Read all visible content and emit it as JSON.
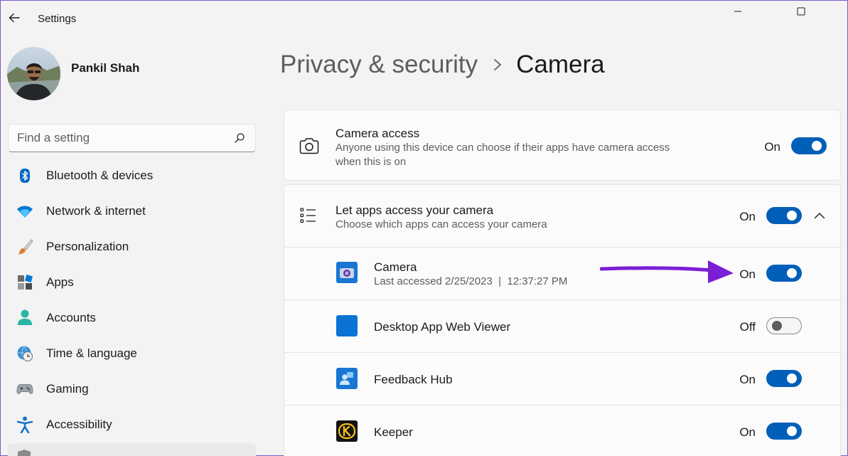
{
  "window": {
    "title": "Settings"
  },
  "profile": {
    "name": "Pankil Shah"
  },
  "search": {
    "placeholder": "Find a setting"
  },
  "nav": {
    "items": [
      {
        "label": "Bluetooth & devices",
        "icon": "bluetooth-icon"
      },
      {
        "label": "Network & internet",
        "icon": "wifi-icon"
      },
      {
        "label": "Personalization",
        "icon": "brush-icon"
      },
      {
        "label": "Apps",
        "icon": "apps-icon"
      },
      {
        "label": "Accounts",
        "icon": "person-icon"
      },
      {
        "label": "Time & language",
        "icon": "globe-clock-icon"
      },
      {
        "label": "Gaming",
        "icon": "gamepad-icon"
      },
      {
        "label": "Accessibility",
        "icon": "accessibility-icon"
      }
    ]
  },
  "header": {
    "parent": "Privacy & security",
    "current": "Camera"
  },
  "camera_access": {
    "title": "Camera access",
    "description": "Anyone using this device can choose if their apps have camera access when this is on",
    "state": "On",
    "enabled": true
  },
  "apps_access": {
    "title": "Let apps access your camera",
    "description": "Choose which apps can access your camera",
    "state": "On",
    "enabled": true,
    "expanded": true
  },
  "apps": [
    {
      "name": "Camera",
      "detail": "Last accessed 2/25/2023  |  12:37:27 PM",
      "state": "On",
      "enabled": true,
      "icon": "camera-app-icon"
    },
    {
      "name": "Desktop App Web Viewer",
      "detail": "",
      "state": "Off",
      "enabled": false,
      "icon": "web-viewer-icon"
    },
    {
      "name": "Feedback Hub",
      "detail": "",
      "state": "On",
      "enabled": true,
      "icon": "feedback-hub-icon"
    },
    {
      "name": "Keeper",
      "detail": "",
      "state": "On",
      "enabled": true,
      "icon": "keeper-icon"
    }
  ],
  "colors": {
    "accent": "#005fb8",
    "annotation_arrow": "#7b1fd6",
    "frame": "#7a57c9"
  }
}
